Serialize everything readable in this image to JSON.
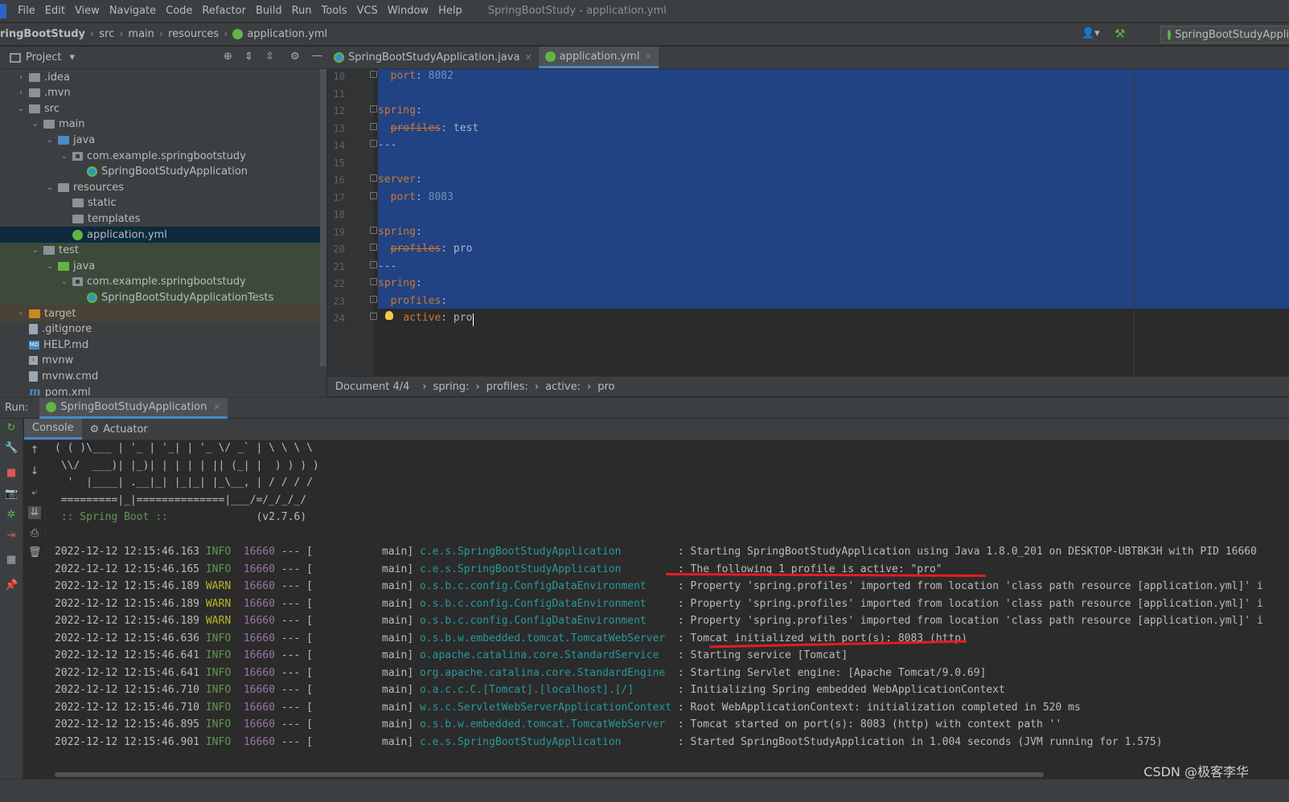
{
  "menu": {
    "items": [
      "File",
      "Edit",
      "View",
      "Navigate",
      "Code",
      "Refactor",
      "Build",
      "Run",
      "Tools",
      "VCS",
      "Window",
      "Help"
    ],
    "window_title": "SpringBootStudy - application.yml"
  },
  "nav": {
    "crumbs": [
      "ringBootStudy",
      "src",
      "main",
      "resources",
      "application.yml"
    ],
    "run_config": "SpringBootStudyApplic"
  },
  "project": {
    "header": "Project",
    "tree": [
      {
        "label": ".idea",
        "depth": 1,
        "arrow": "›",
        "icon": "folder"
      },
      {
        "label": ".mvn",
        "depth": 1,
        "arrow": "›",
        "icon": "folder"
      },
      {
        "label": "src",
        "depth": 1,
        "arrow": "⌄",
        "icon": "folder"
      },
      {
        "label": "main",
        "depth": 2,
        "arrow": "⌄",
        "icon": "folder"
      },
      {
        "label": "java",
        "depth": 3,
        "arrow": "⌄",
        "icon": "folder-blue"
      },
      {
        "label": "com.example.springbootstudy",
        "depth": 4,
        "arrow": "⌄",
        "icon": "package"
      },
      {
        "label": "SpringBootStudyApplication",
        "depth": 5,
        "arrow": "",
        "icon": "spring-class"
      },
      {
        "label": "resources",
        "depth": 3,
        "arrow": "⌄",
        "icon": "folder-res"
      },
      {
        "label": "static",
        "depth": 4,
        "arrow": "",
        "icon": "folder"
      },
      {
        "label": "templates",
        "depth": 4,
        "arrow": "",
        "icon": "folder"
      },
      {
        "label": "application.yml",
        "depth": 4,
        "arrow": "",
        "icon": "yml",
        "selected": true
      },
      {
        "label": "test",
        "depth": 2,
        "arrow": "⌄",
        "icon": "folder",
        "test": true
      },
      {
        "label": "java",
        "depth": 3,
        "arrow": "⌄",
        "icon": "folder-green",
        "test": true
      },
      {
        "label": "com.example.springbootstudy",
        "depth": 4,
        "arrow": "⌄",
        "icon": "package",
        "test": true
      },
      {
        "label": "SpringBootStudyApplicationTests",
        "depth": 5,
        "arrow": "",
        "icon": "spring-class",
        "test": true
      },
      {
        "label": "target",
        "depth": 1,
        "arrow": "›",
        "icon": "folder-orange",
        "excluded": true
      },
      {
        "label": ".gitignore",
        "depth": 1,
        "arrow": "",
        "icon": "file"
      },
      {
        "label": "HELP.md",
        "depth": 1,
        "arrow": "",
        "icon": "md"
      },
      {
        "label": "mvnw",
        "depth": 1,
        "arrow": "",
        "icon": "mvnw"
      },
      {
        "label": "mvnw.cmd",
        "depth": 1,
        "arrow": "",
        "icon": "file"
      },
      {
        "label": "pom.xml",
        "depth": 1,
        "arrow": "",
        "icon": "maven"
      }
    ]
  },
  "editor": {
    "tabs": [
      {
        "label": "SpringBootStudyApplication.java",
        "active": false
      },
      {
        "label": "application.yml",
        "active": true
      }
    ],
    "lines": [
      {
        "n": "10",
        "parts": [
          [
            "  ",
            ""
          ],
          [
            "port",
            "k"
          ],
          [
            ": ",
            ""
          ],
          [
            "8082",
            "n"
          ]
        ]
      },
      {
        "n": "11",
        "parts": []
      },
      {
        "n": "12",
        "parts": [
          [
            "spring",
            "k"
          ],
          [
            ":",
            ""
          ]
        ]
      },
      {
        "n": "13",
        "parts": [
          [
            "  ",
            ""
          ],
          [
            "profiles",
            "k strike"
          ],
          [
            ": test",
            ""
          ]
        ]
      },
      {
        "n": "14",
        "parts": [
          [
            "---",
            ""
          ]
        ]
      },
      {
        "n": "15",
        "parts": []
      },
      {
        "n": "16",
        "parts": [
          [
            "server",
            "k"
          ],
          [
            ":",
            ""
          ]
        ]
      },
      {
        "n": "17",
        "parts": [
          [
            "  ",
            ""
          ],
          [
            "port",
            "k"
          ],
          [
            ": ",
            ""
          ],
          [
            "8083",
            "n"
          ]
        ]
      },
      {
        "n": "18",
        "parts": []
      },
      {
        "n": "19",
        "parts": [
          [
            "spring",
            "k"
          ],
          [
            ":",
            ""
          ]
        ]
      },
      {
        "n": "20",
        "parts": [
          [
            "  ",
            ""
          ],
          [
            "profiles",
            "k strike"
          ],
          [
            ": pro",
            ""
          ]
        ]
      },
      {
        "n": "21",
        "parts": [
          [
            "---",
            ""
          ]
        ]
      },
      {
        "n": "22",
        "parts": [
          [
            "spring",
            "k"
          ],
          [
            ":",
            ""
          ]
        ]
      },
      {
        "n": "23",
        "parts": [
          [
            "  ",
            ""
          ],
          [
            "profiles",
            "k"
          ],
          [
            ":",
            ""
          ]
        ]
      },
      {
        "n": "24",
        "parts": [
          [
            "    ",
            ""
          ],
          [
            "active",
            "k"
          ],
          [
            ": pro",
            ""
          ]
        ]
      }
    ],
    "breadcrumb": [
      "Document 4/4",
      "spring:",
      "profiles:",
      "active:",
      "pro"
    ]
  },
  "run": {
    "label": "Run:",
    "tab": "SpringBootStudyApplication",
    "console_tabs": [
      "Console",
      "Actuator"
    ],
    "banner": [
      "( ( )\\___ | '_ | '_| | '_ \\/ _` | \\ \\ \\ \\",
      " \\\\/  ___)| |_)| | | | | || (_| |  ) ) ) )",
      "  '  |____| .__|_| |_|_| |_\\__, | / / / /",
      " =========|_|==============|___/=/_/_/_/"
    ],
    "spring_boot_label": " :: Spring Boot ::",
    "spring_boot_version": "(v2.7.6)",
    "log": [
      {
        "ts": "2022-12-12 12:15:46.163",
        "level": "INFO",
        "pid": "16660",
        "thread": "main",
        "logger": "c.e.s.SpringBootStudyApplication",
        "msg": "Starting SpringBootStudyApplication using Java 1.8.0_201 on DESKTOP-UBTBK3H with PID 16660"
      },
      {
        "ts": "2022-12-12 12:15:46.165",
        "level": "INFO",
        "pid": "16660",
        "thread": "main",
        "logger": "c.e.s.SpringBootStudyApplication",
        "msg": "The following 1 profile is active: \"pro\""
      },
      {
        "ts": "2022-12-12 12:15:46.189",
        "level": "WARN",
        "pid": "16660",
        "thread": "main",
        "logger": "o.s.b.c.config.ConfigDataEnvironment",
        "msg": "Property 'spring.profiles' imported from location 'class path resource [application.yml]' i"
      },
      {
        "ts": "2022-12-12 12:15:46.189",
        "level": "WARN",
        "pid": "16660",
        "thread": "main",
        "logger": "o.s.b.c.config.ConfigDataEnvironment",
        "msg": "Property 'spring.profiles' imported from location 'class path resource [application.yml]' i"
      },
      {
        "ts": "2022-12-12 12:15:46.189",
        "level": "WARN",
        "pid": "16660",
        "thread": "main",
        "logger": "o.s.b.c.config.ConfigDataEnvironment",
        "msg": "Property 'spring.profiles' imported from location 'class path resource [application.yml]' i"
      },
      {
        "ts": "2022-12-12 12:15:46.636",
        "level": "INFO",
        "pid": "16660",
        "thread": "main",
        "logger": "o.s.b.w.embedded.tomcat.TomcatWebServer",
        "msg": "Tomcat initialized with port(s): 8083 (http)"
      },
      {
        "ts": "2022-12-12 12:15:46.641",
        "level": "INFO",
        "pid": "16660",
        "thread": "main",
        "logger": "o.apache.catalina.core.StandardService",
        "msg": "Starting service [Tomcat]"
      },
      {
        "ts": "2022-12-12 12:15:46.641",
        "level": "INFO",
        "pid": "16660",
        "thread": "main",
        "logger": "org.apache.catalina.core.StandardEngine",
        "msg": "Starting Servlet engine: [Apache Tomcat/9.0.69]"
      },
      {
        "ts": "2022-12-12 12:15:46.710",
        "level": "INFO",
        "pid": "16660",
        "thread": "main",
        "logger": "o.a.c.c.C.[Tomcat].[localhost].[/]",
        "msg": "Initializing Spring embedded WebApplicationContext"
      },
      {
        "ts": "2022-12-12 12:15:46.710",
        "level": "INFO",
        "pid": "16660",
        "thread": "main",
        "logger": "w.s.c.ServletWebServerApplicationContext",
        "msg": "Root WebApplicationContext: initialization completed in 520 ms"
      },
      {
        "ts": "2022-12-12 12:15:46.895",
        "level": "INFO",
        "pid": "16660",
        "thread": "main",
        "logger": "o.s.b.w.embedded.tomcat.TomcatWebServer",
        "msg": "Tomcat started on port(s): 8083 (http) with context path ''"
      },
      {
        "ts": "2022-12-12 12:15:46.901",
        "level": "INFO",
        "pid": "16660",
        "thread": "main",
        "logger": "c.e.s.SpringBootStudyApplication",
        "msg": "Started SpringBootStudyApplication in 1.004 seconds (JVM running for 1.575)"
      }
    ]
  },
  "watermark": "CSDN @极客李华"
}
